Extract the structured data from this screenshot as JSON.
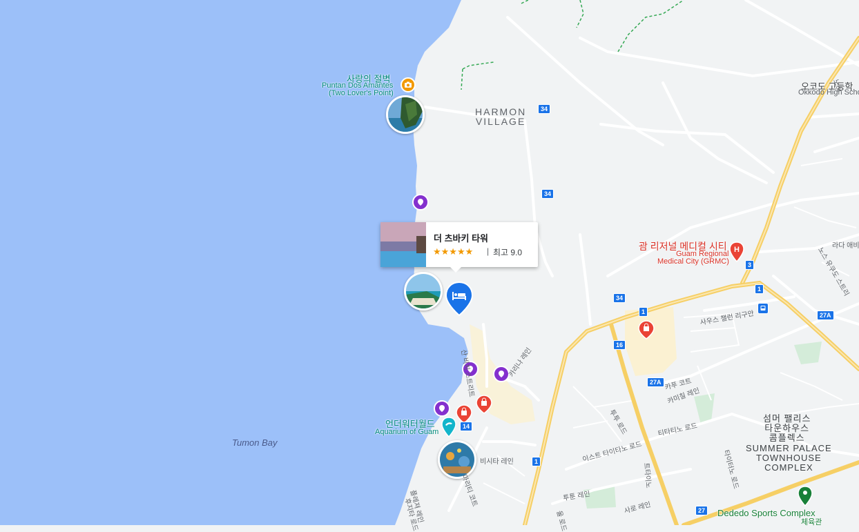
{
  "map": {
    "water_label": "Tumon Bay",
    "areas": {
      "harmon": [
        "HARMON",
        "VILLAGE"
      ],
      "summer_palace_ko": [
        "섬머 팰리스",
        "타운하우스",
        "콤플렉스"
      ],
      "summer_palace_en": [
        "SUMMER PALACE",
        "TOWNHOUSE",
        "COMPLEX"
      ]
    },
    "pois": {
      "two_lovers_ko": "사랑의 절벽",
      "two_lovers_en_1": "Puntan Dos Amantes",
      "two_lovers_en_2": "(Two Lover's Point)",
      "aquarium_ko": "언더워터월드",
      "aquarium_en": "Aquarium of Guam",
      "okkodo_ko": "오코도 고등학",
      "okkodo_en": "Okkodo High Scho",
      "hospital_ko": "괌 리저널 메디컬 시티",
      "hospital_en_1": "Guam Regional",
      "hospital_en_2": "Medical City (GRMC)",
      "dededo_en": "Dededo Sports Complex",
      "dededo_ko": "체육관"
    },
    "streets": {
      "s1": "산 비치 스트리트",
      "s2": "카푸 코트",
      "s3": "카미칠 레인",
      "s4": "사우스 챌런 리구안",
      "s5": "티타티노 로드",
      "s6": "이스트 타이타노 로드",
      "s7": "비시타 레인",
      "s8": "투툰 레인",
      "s9": "사로 레인",
      "s10": "타이터노 로드",
      "s11": "노스 유쿠도 스트리",
      "s12": "라다 애비",
      "s13": "투투 로드",
      "s14": "트타이노",
      "s15": "마리티 코트",
      "s16": "플레져 레인",
      "s17": "후지타 로드",
      "s18": "카리나 레인",
      "s19": "울 로드",
      "s20": "노스"
    },
    "route_shields": [
      "34",
      "34",
      "34",
      "1",
      "16",
      "27A",
      "3",
      "1",
      "27A",
      "14",
      "1",
      "27"
    ],
    "accent_water": "#9cc0f9",
    "accent_pin": "#8430ce",
    "accent_hotel": "#1a73e8",
    "accent_shop": "#ea4335"
  },
  "hotel_card": {
    "title": "더 츠바키 타워",
    "stars": "★★★★★",
    "separator": "|",
    "rating": "최고 9.0"
  },
  "icons": {
    "hotel": "hotel-bed-icon",
    "camera": "camera-icon",
    "pin": "location-pin-icon",
    "shopping": "shopping-bag-icon",
    "hospital": "hospital-icon",
    "bus": "bus-icon",
    "sports": "sports-pin-icon",
    "dolphin": "dolphin-icon"
  }
}
